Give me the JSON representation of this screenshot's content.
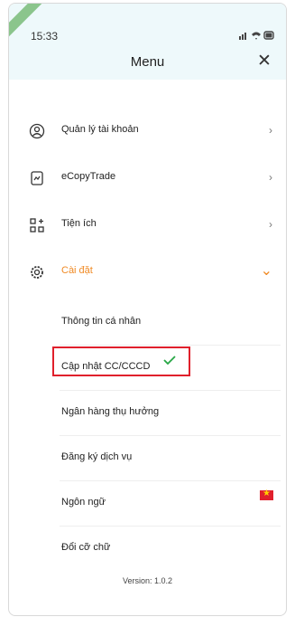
{
  "status": {
    "time": "15:33"
  },
  "header": {
    "title": "Menu",
    "close_glyph": "✕"
  },
  "menu": {
    "items": [
      {
        "label": "Quản lý tài khoản",
        "icon": "user-circle-icon",
        "chevron": "›"
      },
      {
        "label": "eCopyTrade",
        "icon": "copy-trade-icon",
        "chevron": "›"
      },
      {
        "label": "Tiện ích",
        "icon": "apps-icon",
        "chevron": "›"
      },
      {
        "label": "Cài đặt",
        "icon": "gear-icon",
        "chevron": "⌄"
      }
    ],
    "settings_sub": [
      {
        "label": "Thông tin cá nhân"
      },
      {
        "label": "Cập nhật CC/CCCD"
      },
      {
        "label": "Ngân hàng thụ hưởng"
      },
      {
        "label": "Đăng ký dịch vụ"
      },
      {
        "label": "Ngôn ngữ"
      },
      {
        "label": "Đổi cỡ chữ"
      }
    ]
  },
  "version": "Version: 1.0.2",
  "colors": {
    "accent": "#f08a24",
    "highlight": "#e0202c",
    "check": "#27a745"
  }
}
